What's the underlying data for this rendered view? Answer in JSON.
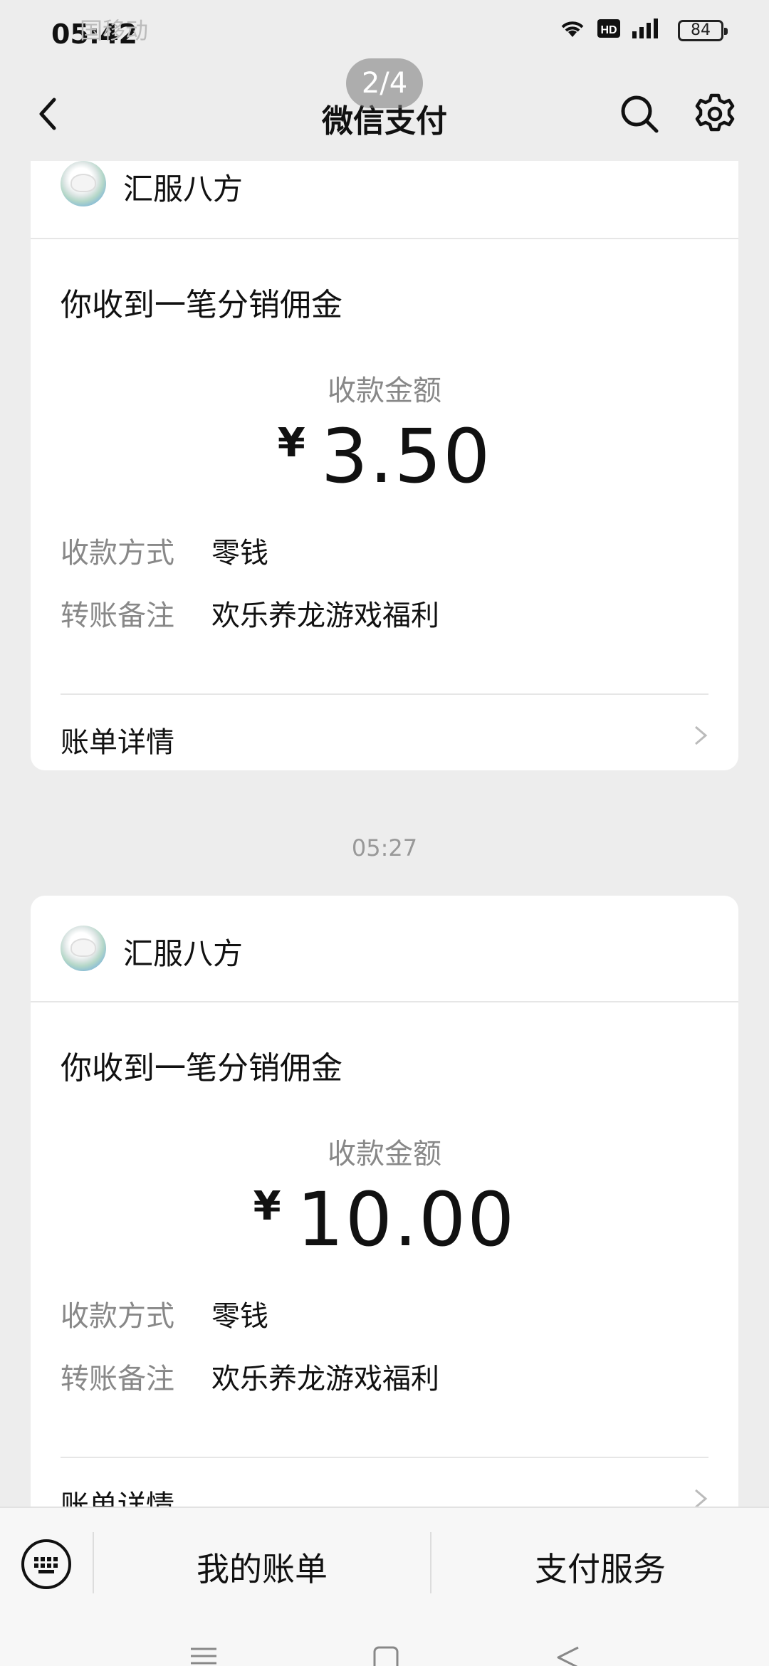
{
  "status_bar": {
    "time": "05:42",
    "carrier": "国移动",
    "battery": "84"
  },
  "pager": {
    "label": "2/4"
  },
  "nav": {
    "title": "微信支付"
  },
  "cards": [
    {
      "merchant": "汇服八方",
      "headline": "你收到一笔分销佣金",
      "amount_label": "收款金额",
      "currency": "¥",
      "amount": "3.50",
      "method_label": "收款方式",
      "method_value": "零钱",
      "note_label": "转账备注",
      "note_value": "欢乐养龙游戏福利",
      "detail_label": "账单详情"
    },
    {
      "merchant": "汇服八方",
      "headline": "你收到一笔分销佣金",
      "amount_label": "收款金额",
      "currency": "¥",
      "amount": "10.00",
      "method_label": "收款方式",
      "method_value": "零钱",
      "note_label": "转账备注",
      "note_value": "欢乐养龙游戏福利",
      "detail_label": "账单详情"
    }
  ],
  "timestamp": "05:27",
  "bottom_bar": {
    "tab1": "我的账单",
    "tab2": "支付服务"
  }
}
